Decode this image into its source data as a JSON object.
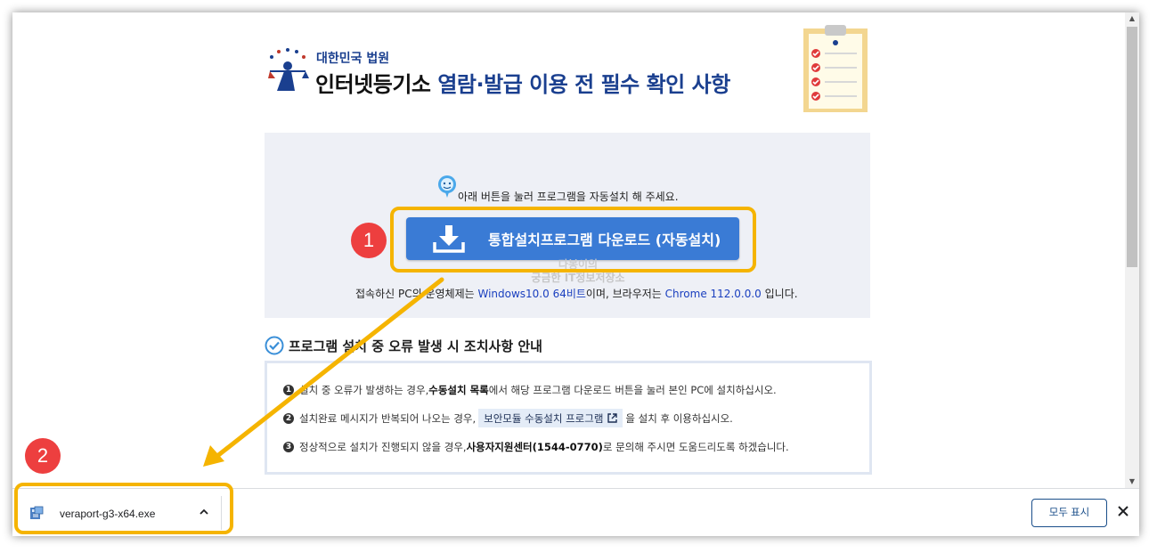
{
  "header": {
    "court_name": "대한민국 법원",
    "title_part1": "인터넷등기소 ",
    "title_part2": "열람·발급 이용 전 필수 확인 사항"
  },
  "install": {
    "hint": "아래 버튼을 눌러 프로그램을 자동설치 해 주세요.",
    "button_label": "통합설치프로그램 다운로드 (자동설치)",
    "env_prefix": "접속하신 PC의 운영체제는 ",
    "os": "Windows10.0 64비트",
    "env_middle": "이며, 브라우저는 ",
    "browser": "Chrome 112.0.0.0",
    "env_suffix": " 입니다."
  },
  "watermark": {
    "line1": "다봉이의",
    "line2": "궁금한 IT정보저장소"
  },
  "errors": {
    "heading": "프로그램 설치 중 오류 발생 시 조치사항 안내",
    "item1_num": "1",
    "item1_a": "설치 중 오류가 발생하는 경우, ",
    "item1_b": "수동설치 목록",
    "item1_c": "에서 해당 프로그램 다운로드 버튼을 눌러 본인 PC에 설치하십시오.",
    "item2_num": "2",
    "item2_a": "설치완료 메시지가 반복되어 나오는 경우,",
    "item2_button": "보안모듈 수동설치 프로그램",
    "item2_c": "을 설치 후 이용하십시오.",
    "item3_num": "3",
    "item3_a": "정상적으로 설치가 진행되지 않을 경우, ",
    "item3_b": "사용자지원센터(1544-0770)",
    "item3_c": "로 문의해 주시면 도움드리도록 하겠습니다."
  },
  "annotations": {
    "badge1": "1",
    "badge2": "2",
    "highlight_color": "#f5b400",
    "badge_color": "#ed3f3f"
  },
  "download_shelf": {
    "filename": "veraport-g3-x64.exe",
    "show_all_label": "모두 표시"
  },
  "icons": {
    "emblem": "court-emblem-icon",
    "clipboard": "checklist-clipboard-icon",
    "download": "download-arrow-icon",
    "chevron": "chevron-up-icon",
    "close": "close-icon"
  },
  "colors": {
    "brand_blue": "#1a3f8f",
    "button_blue": "#3a7bd5",
    "info_blue": "#1a3fbf"
  }
}
